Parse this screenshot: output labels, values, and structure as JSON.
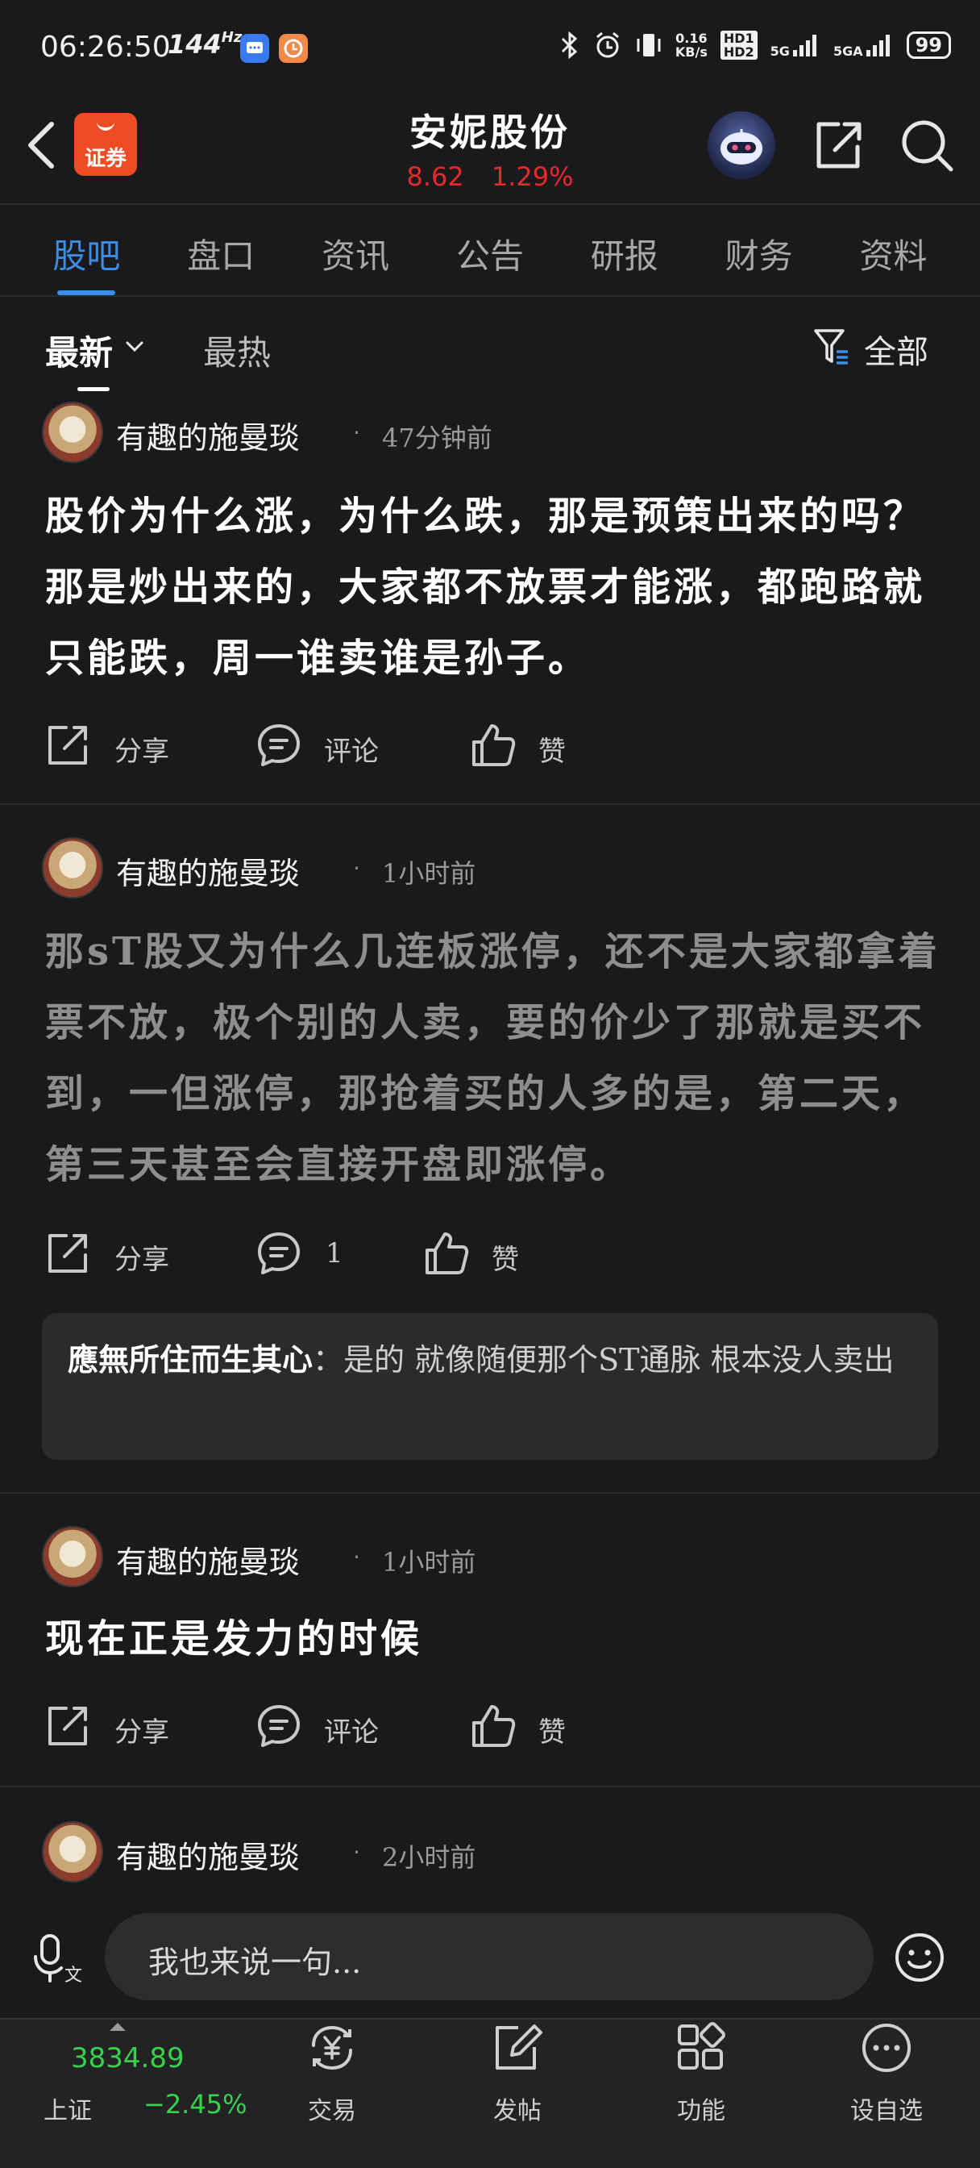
{
  "status_bar": {
    "time": "06:26:50",
    "refresh_rate": "144",
    "refresh_unit": "Hz",
    "network_speed": "0.16",
    "network_unit": "KB/s",
    "hd1": "HD1",
    "hd2": "HD2",
    "signal1": "5G",
    "signal2": "5GA",
    "battery": "99"
  },
  "header": {
    "brand_logo_text": "证券",
    "stock_name": "安妮股份",
    "price": "8.62",
    "change_pct": "1.29%",
    "price_color": "#e8282a"
  },
  "tabs": [
    {
      "label": "股吧",
      "active": true
    },
    {
      "label": "盘口",
      "active": false
    },
    {
      "label": "资讯",
      "active": false
    },
    {
      "label": "公告",
      "active": false
    },
    {
      "label": "研报",
      "active": false
    },
    {
      "label": "财务",
      "active": false
    },
    {
      "label": "资料",
      "active": false
    }
  ],
  "sort_bar": {
    "latest": "最新",
    "hot": "最热",
    "filter": "全部"
  },
  "posts": [
    {
      "author": "有趣的施曼琰",
      "time": "47分钟前",
      "text": "股价为什么涨，为什么跌，那是预策出来的吗？那是炒出来的，大家都不放票才能涨，都跑路就只能跌，周一谁卖谁是孙子。",
      "share": "分享",
      "comment": "评论",
      "like": "赞"
    },
    {
      "author": "有趣的施曼琰",
      "time": "1小时前",
      "text": "那sT股又为什么几连板涨停，还不是大家都拿着票不放，极个别的人卖，要的价少了那就是买不到，一但涨停，那抢着买的人多的是，第二天，第三天甚至会直接开盘即涨停。",
      "share": "分享",
      "comment": "1",
      "like": "赞",
      "reply_author": "應無所住而生其心",
      "reply_text": "：是的 就像随便那个ST通脉 根本没人卖出"
    },
    {
      "author": "有趣的施曼琰",
      "time": "1小时前",
      "text": "现在正是发力的时候",
      "share": "分享",
      "comment": "评论",
      "like": "赞"
    },
    {
      "author": "有趣的施曼琰",
      "time": "2小时前"
    }
  ],
  "comment_bar": {
    "placeholder": "我也来说一句..."
  },
  "bottom_nav": {
    "index_value": "3834.89",
    "index_name": "上证",
    "index_change": "−2.45%",
    "index_color": "#37d14a",
    "items": [
      {
        "label": "交易",
        "icon": "yuan-exchange-icon"
      },
      {
        "label": "发帖",
        "icon": "edit-icon"
      },
      {
        "label": "功能",
        "icon": "grid-icon"
      },
      {
        "label": "设自选",
        "icon": "more-icon"
      }
    ]
  }
}
